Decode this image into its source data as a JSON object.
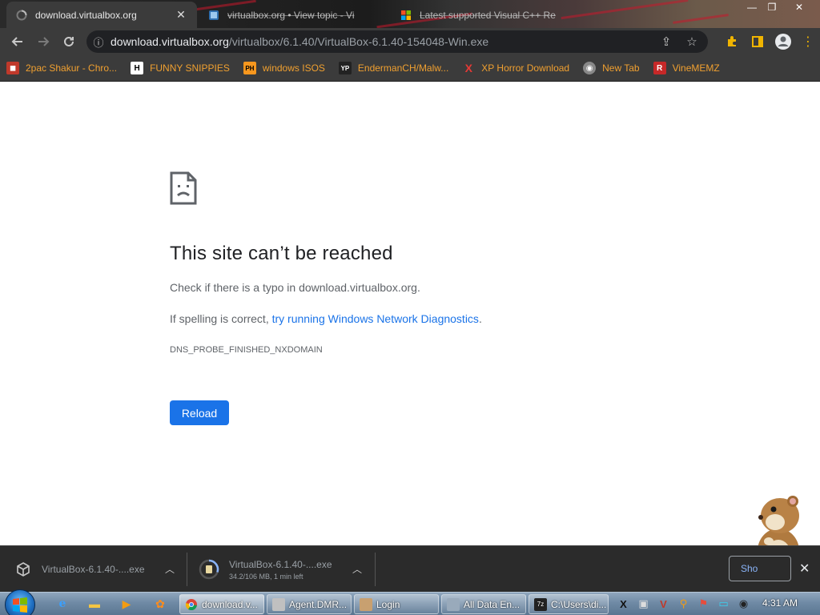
{
  "browser": {
    "tabs": [
      {
        "title": "download.virtualbox.org",
        "icon": "loading-icon",
        "active": true
      },
      {
        "title": "virtualbox.org • View topic - Vi",
        "icon": "virtualbox-forum-icon",
        "active": false
      },
      {
        "title": "Latest supported Visual C++ Re",
        "icon": "microsoft-icon",
        "active": false
      }
    ],
    "url_host": "download.virtualbox.org",
    "url_path": "/virtualbox/6.1.40/VirtualBox-6.1.40-154048-Win.exe"
  },
  "bookmarks": [
    {
      "label": "2pac Shakur - Chro...",
      "icon": "2pac-icon",
      "color": "#c0392b"
    },
    {
      "label": "FUNNY SNIPPIES",
      "icon": "H",
      "color": "#ffffff"
    },
    {
      "label": "windows ISOS",
      "icon": "PH",
      "color": "#f7971e"
    },
    {
      "label": "EndermanCH/Malw...",
      "icon": "YP",
      "color": "#222222"
    },
    {
      "label": "XP Horror Download",
      "icon": "X",
      "color": "#e53935"
    },
    {
      "label": "New Tab",
      "icon": "new-tab-icon",
      "color": "#888888"
    },
    {
      "label": "VineMEMZ",
      "icon": "R",
      "color": "#c62828"
    }
  ],
  "error_page": {
    "title": "This site can’t be reached",
    "check_text": "Check if there is a typo in download.virtualbox.org.",
    "spelling_prefix": "If spelling is correct, ",
    "diagnostics_link": "try running Windows Network Diagnostics",
    "diagnostics_suffix": ".",
    "error_code": "DNS_PROBE_FINISHED_NXDOMAIN",
    "reload_label": "Reload"
  },
  "downloads": {
    "items": [
      {
        "name": "VirtualBox-6.1.40-....exe",
        "status": ""
      },
      {
        "name": "VirtualBox-6.1.40-....exe",
        "status": "34.2/106 MB, 1 min left"
      }
    ],
    "show_all_label": "Sho"
  },
  "taskbar": {
    "tasks": [
      {
        "label": "download.v...",
        "icon_color": "#4285f4",
        "active": true
      },
      {
        "label": "Agent.DMR...",
        "icon_color": "#c0c0c0",
        "active": false
      },
      {
        "label": "Login",
        "icon_color": "#c8a070",
        "active": false
      },
      {
        "label": "All Data En...",
        "icon_color": "#9ab",
        "active": false
      },
      {
        "label": "C:\\Users\\di...",
        "icon_color": "#222",
        "active": false
      }
    ],
    "clock": "4:31 AM"
  },
  "colors": {
    "link": "#1a73e8",
    "reload_button": "#1a73e8",
    "bookmark_text": "#f0a030"
  }
}
